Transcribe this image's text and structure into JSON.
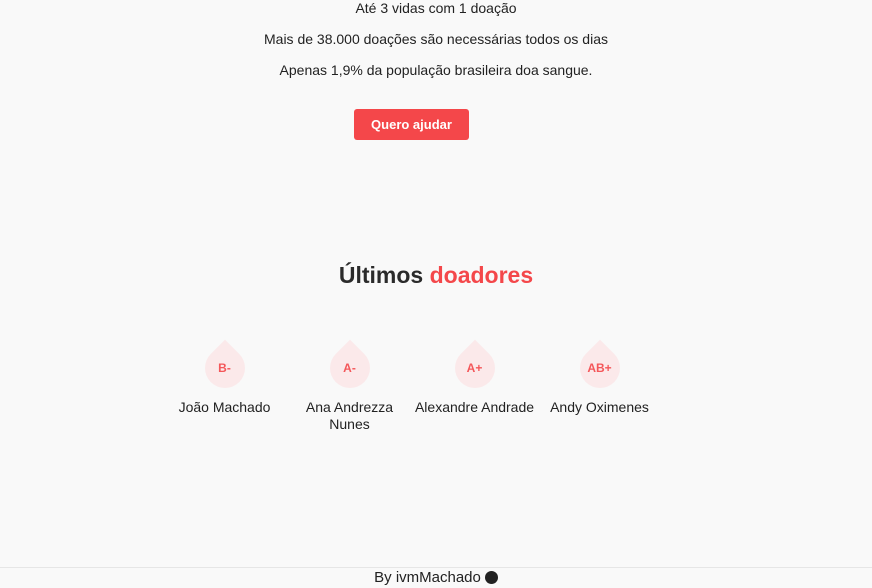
{
  "hero": {
    "stats": [
      "Até 3 vidas com 1 doação",
      "Mais de 38.000 doações são necessárias todos os dias",
      "Apenas 1,9% da população brasileira doa sangue."
    ],
    "cta_label": "Quero ajudar"
  },
  "donors_section": {
    "title_plain": "Últimos",
    "title_highlight": "doadores",
    "donors": [
      {
        "blood_type": "B-",
        "name": "João Machado"
      },
      {
        "blood_type": "A-",
        "name": "Ana Andrezza Nunes"
      },
      {
        "blood_type": "A+",
        "name": "Alexandre Andrade"
      },
      {
        "blood_type": "AB+",
        "name": "Andy Oximenes"
      }
    ]
  },
  "footer": {
    "text": "By ivmMachado",
    "icon": "github-icon"
  },
  "colors": {
    "accent": "#f4474a",
    "drop_bg": "#fbe9ea"
  }
}
